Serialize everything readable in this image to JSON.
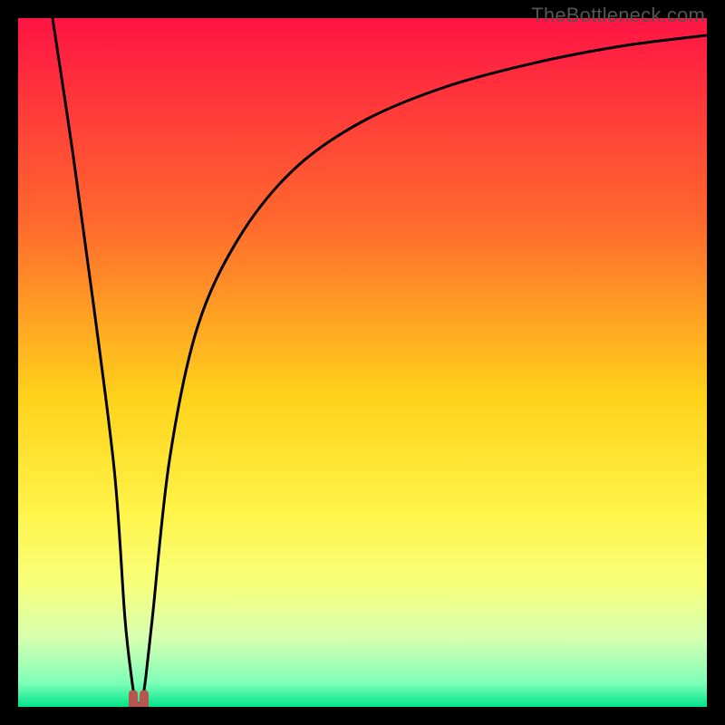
{
  "watermark": "TheBottleneck.com",
  "chart_data": {
    "type": "line",
    "title": "",
    "xlabel": "",
    "ylabel": "",
    "xlim": [
      0,
      100
    ],
    "ylim": [
      0,
      100
    ],
    "grid": false,
    "series": [
      {
        "name": "bottleneck-curve",
        "x": [
          5,
          8,
          11,
          14,
          15.5,
          16.5,
          17,
          17.5,
          18,
          18.5,
          19.5,
          22,
          26,
          32,
          40,
          50,
          62,
          75,
          88,
          100
        ],
        "values": [
          100,
          80,
          58,
          34,
          13,
          4,
          1,
          0.5,
          1,
          4,
          13,
          36,
          55,
          68,
          78,
          85,
          90,
          93.5,
          96,
          97.5
        ]
      }
    ],
    "marker": {
      "name": "notch-marker",
      "x": 17.5,
      "y": 0,
      "color": "#b7564c"
    },
    "background_gradient": {
      "stops": [
        {
          "pos": 0.0,
          "color": "#ff1444"
        },
        {
          "pos": 0.3,
          "color": "#ff6a2d"
        },
        {
          "pos": 0.55,
          "color": "#ffd21a"
        },
        {
          "pos": 0.72,
          "color": "#fff44a"
        },
        {
          "pos": 0.82,
          "color": "#f8ff7a"
        },
        {
          "pos": 0.9,
          "color": "#d7ffb0"
        },
        {
          "pos": 0.965,
          "color": "#7fffb8"
        },
        {
          "pos": 1.0,
          "color": "#00e58a"
        }
      ]
    }
  }
}
